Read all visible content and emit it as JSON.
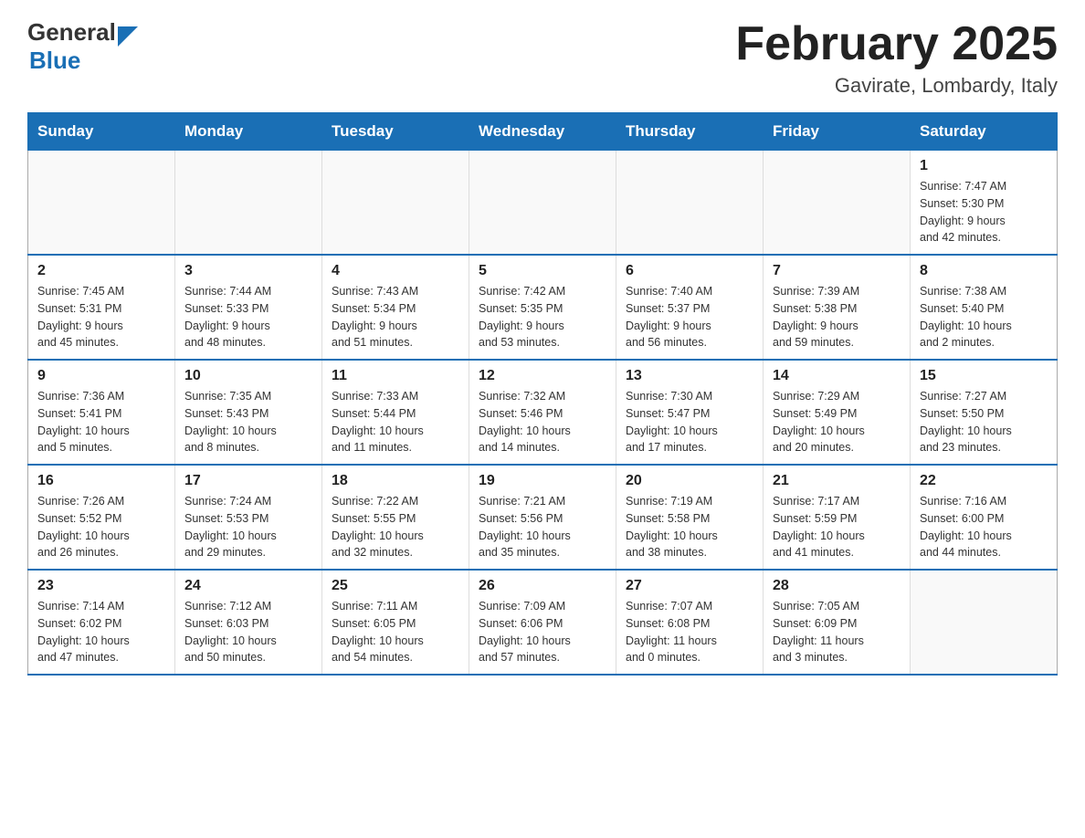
{
  "header": {
    "logo_general": "General",
    "logo_blue": "Blue",
    "month_title": "February 2025",
    "location": "Gavirate, Lombardy, Italy"
  },
  "weekdays": [
    "Sunday",
    "Monday",
    "Tuesday",
    "Wednesday",
    "Thursday",
    "Friday",
    "Saturday"
  ],
  "weeks": [
    [
      {
        "day": "",
        "info": ""
      },
      {
        "day": "",
        "info": ""
      },
      {
        "day": "",
        "info": ""
      },
      {
        "day": "",
        "info": ""
      },
      {
        "day": "",
        "info": ""
      },
      {
        "day": "",
        "info": ""
      },
      {
        "day": "1",
        "info": "Sunrise: 7:47 AM\nSunset: 5:30 PM\nDaylight: 9 hours\nand 42 minutes."
      }
    ],
    [
      {
        "day": "2",
        "info": "Sunrise: 7:45 AM\nSunset: 5:31 PM\nDaylight: 9 hours\nand 45 minutes."
      },
      {
        "day": "3",
        "info": "Sunrise: 7:44 AM\nSunset: 5:33 PM\nDaylight: 9 hours\nand 48 minutes."
      },
      {
        "day": "4",
        "info": "Sunrise: 7:43 AM\nSunset: 5:34 PM\nDaylight: 9 hours\nand 51 minutes."
      },
      {
        "day": "5",
        "info": "Sunrise: 7:42 AM\nSunset: 5:35 PM\nDaylight: 9 hours\nand 53 minutes."
      },
      {
        "day": "6",
        "info": "Sunrise: 7:40 AM\nSunset: 5:37 PM\nDaylight: 9 hours\nand 56 minutes."
      },
      {
        "day": "7",
        "info": "Sunrise: 7:39 AM\nSunset: 5:38 PM\nDaylight: 9 hours\nand 59 minutes."
      },
      {
        "day": "8",
        "info": "Sunrise: 7:38 AM\nSunset: 5:40 PM\nDaylight: 10 hours\nand 2 minutes."
      }
    ],
    [
      {
        "day": "9",
        "info": "Sunrise: 7:36 AM\nSunset: 5:41 PM\nDaylight: 10 hours\nand 5 minutes."
      },
      {
        "day": "10",
        "info": "Sunrise: 7:35 AM\nSunset: 5:43 PM\nDaylight: 10 hours\nand 8 minutes."
      },
      {
        "day": "11",
        "info": "Sunrise: 7:33 AM\nSunset: 5:44 PM\nDaylight: 10 hours\nand 11 minutes."
      },
      {
        "day": "12",
        "info": "Sunrise: 7:32 AM\nSunset: 5:46 PM\nDaylight: 10 hours\nand 14 minutes."
      },
      {
        "day": "13",
        "info": "Sunrise: 7:30 AM\nSunset: 5:47 PM\nDaylight: 10 hours\nand 17 minutes."
      },
      {
        "day": "14",
        "info": "Sunrise: 7:29 AM\nSunset: 5:49 PM\nDaylight: 10 hours\nand 20 minutes."
      },
      {
        "day": "15",
        "info": "Sunrise: 7:27 AM\nSunset: 5:50 PM\nDaylight: 10 hours\nand 23 minutes."
      }
    ],
    [
      {
        "day": "16",
        "info": "Sunrise: 7:26 AM\nSunset: 5:52 PM\nDaylight: 10 hours\nand 26 minutes."
      },
      {
        "day": "17",
        "info": "Sunrise: 7:24 AM\nSunset: 5:53 PM\nDaylight: 10 hours\nand 29 minutes."
      },
      {
        "day": "18",
        "info": "Sunrise: 7:22 AM\nSunset: 5:55 PM\nDaylight: 10 hours\nand 32 minutes."
      },
      {
        "day": "19",
        "info": "Sunrise: 7:21 AM\nSunset: 5:56 PM\nDaylight: 10 hours\nand 35 minutes."
      },
      {
        "day": "20",
        "info": "Sunrise: 7:19 AM\nSunset: 5:58 PM\nDaylight: 10 hours\nand 38 minutes."
      },
      {
        "day": "21",
        "info": "Sunrise: 7:17 AM\nSunset: 5:59 PM\nDaylight: 10 hours\nand 41 minutes."
      },
      {
        "day": "22",
        "info": "Sunrise: 7:16 AM\nSunset: 6:00 PM\nDaylight: 10 hours\nand 44 minutes."
      }
    ],
    [
      {
        "day": "23",
        "info": "Sunrise: 7:14 AM\nSunset: 6:02 PM\nDaylight: 10 hours\nand 47 minutes."
      },
      {
        "day": "24",
        "info": "Sunrise: 7:12 AM\nSunset: 6:03 PM\nDaylight: 10 hours\nand 50 minutes."
      },
      {
        "day": "25",
        "info": "Sunrise: 7:11 AM\nSunset: 6:05 PM\nDaylight: 10 hours\nand 54 minutes."
      },
      {
        "day": "26",
        "info": "Sunrise: 7:09 AM\nSunset: 6:06 PM\nDaylight: 10 hours\nand 57 minutes."
      },
      {
        "day": "27",
        "info": "Sunrise: 7:07 AM\nSunset: 6:08 PM\nDaylight: 11 hours\nand 0 minutes."
      },
      {
        "day": "28",
        "info": "Sunrise: 7:05 AM\nSunset: 6:09 PM\nDaylight: 11 hours\nand 3 minutes."
      },
      {
        "day": "",
        "info": ""
      }
    ]
  ]
}
